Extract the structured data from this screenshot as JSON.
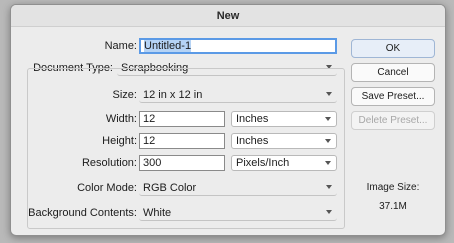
{
  "dialog": {
    "title": "New"
  },
  "form": {
    "name": {
      "label": "Name:",
      "value": "Untitled-1"
    },
    "document_type": {
      "label": "Document Type:",
      "value": "Scrapbooking"
    },
    "size": {
      "label": "Size:",
      "value": "12 in x 12 in"
    },
    "width": {
      "label": "Width:",
      "value": "12",
      "unit": "Inches"
    },
    "height": {
      "label": "Height:",
      "value": "12",
      "unit": "Inches"
    },
    "resolution": {
      "label": "Resolution:",
      "value": "300",
      "unit": "Pixels/Inch"
    },
    "color_mode": {
      "label": "Color Mode:",
      "value": "RGB Color"
    },
    "background_contents": {
      "label": "Background Contents:",
      "value": "White"
    }
  },
  "buttons": {
    "ok": "OK",
    "cancel": "Cancel",
    "save_preset": "Save Preset...",
    "delete_preset": "Delete Preset..."
  },
  "image_size": {
    "label": "Image Size:",
    "value": "37.1M"
  }
}
